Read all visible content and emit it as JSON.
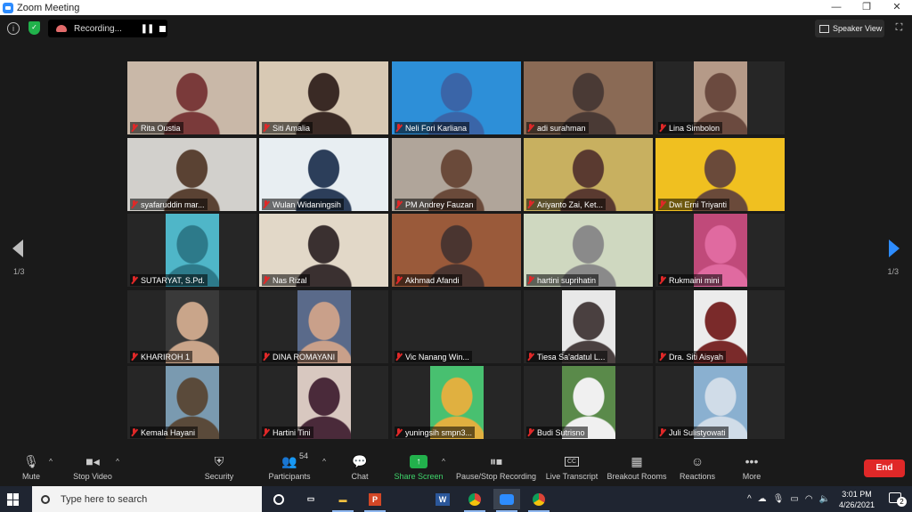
{
  "window": {
    "title": "Zoom Meeting",
    "controls": [
      "—",
      "❐",
      "✕"
    ]
  },
  "topbar": {
    "recording_label": "Recording...",
    "speaker_view_label": "Speaker View"
  },
  "pagination": {
    "left": "1/3",
    "right": "1/3"
  },
  "participants": [
    {
      "name": "Rita Oustia",
      "bg": "#c9b8a8",
      "fg": "#7a3a3a"
    },
    {
      "name": "Siti Amalia",
      "bg": "#d8c9b4",
      "fg": "#3a2a25",
      "active": true
    },
    {
      "name": "Neli Fori Karliana",
      "bg": "#2d8fd8",
      "fg": "#3a65a8"
    },
    {
      "name": "adi surahman",
      "bg": "#8a6a55",
      "fg": "#4a3a35"
    },
    {
      "name": "Lina Simbolon",
      "bg": "#b59a88",
      "fg": "#6b4a3f"
    },
    {
      "name": "syafaruddin mar...",
      "bg": "#d2d0cc",
      "fg": "#5a4233"
    },
    {
      "name": "Wulan Widaningsih",
      "bg": "#e8eef2",
      "fg": "#2c3e5a"
    },
    {
      "name": "PM Andrey Fauzan",
      "bg": "#b0a59a",
      "fg": "#6a4a3a"
    },
    {
      "name": "Ariyanto Zai, Ket...",
      "bg": "#c8b060",
      "fg": "#5a3a30"
    },
    {
      "name": "Dwi Erni Triyanti",
      "bg": "#f0c020",
      "fg": "#6a4a3a"
    },
    {
      "name": "SUTARYAT, S.Pd.",
      "bg": "#4fb6c8",
      "fg": "#2d7a8a"
    },
    {
      "name": "Nas Rizal",
      "bg": "#e2d8c8",
      "fg": "#3a3030"
    },
    {
      "name": "Akhmad Afandi",
      "bg": "#9a5a3a",
      "fg": "#4a3530"
    },
    {
      "name": "hartini suprihatin",
      "bg": "#cfd8c0",
      "fg": "#8a8a8a"
    },
    {
      "name": "Rukmaini mini",
      "bg": "#c04a7a",
      "fg": "#e06aa0"
    },
    {
      "name": "KHARIROH 1",
      "bg": "#3a3a3a",
      "fg": "#c9a58a"
    },
    {
      "name": "DINA ROMAYANI",
      "bg": "#5a6a8a",
      "fg": "#c9a08a"
    },
    {
      "name": "Vic Nanang Win...",
      "bg": "#262626",
      "fg": "#262626"
    },
    {
      "name": "Tiesa Sa'adatul L...",
      "bg": "#e8e8e8",
      "fg": "#4a4040"
    },
    {
      "name": "Dra. Siti Aisyah",
      "bg": "#ececec",
      "fg": "#7a2a2a"
    },
    {
      "name": "Kemala Hayani",
      "bg": "#7a9ab0",
      "fg": "#5a4a3a"
    },
    {
      "name": "Hartini Tini",
      "bg": "#d8c8c0",
      "fg": "#4a2a3a"
    },
    {
      "name": "yuningsih smpn3...",
      "bg": "#48c070",
      "fg": "#e0b040"
    },
    {
      "name": "Budi Sutrisno",
      "bg": "#5a8a4a",
      "fg": "#f0f0f0"
    },
    {
      "name": "Juli Sulistyowati",
      "bg": "#8ab0d0",
      "fg": "#d0dce8"
    }
  ],
  "toolbar": {
    "mute": "Mute",
    "stop_video": "Stop Video",
    "security": "Security",
    "participants": "Participants",
    "participants_count": "54",
    "chat": "Chat",
    "share_screen": "Share Screen",
    "pause_stop_recording": "Pause/Stop Recording",
    "live_transcript": "Live Transcript",
    "cc_label": "CC",
    "breakout_rooms": "Breakout Rooms",
    "reactions": "Reactions",
    "more": "More",
    "end": "End"
  },
  "taskbar": {
    "search_placeholder": "Type here to search",
    "time": "3:01 PM",
    "date": "4/26/2021",
    "notification_count": "2",
    "apps": [
      "cortana-icon",
      "task-view-icon",
      "file-explorer-icon",
      "powerpoint-icon",
      "word-icon",
      "chrome-icon",
      "zoom-icon",
      "chrome-icon"
    ]
  }
}
